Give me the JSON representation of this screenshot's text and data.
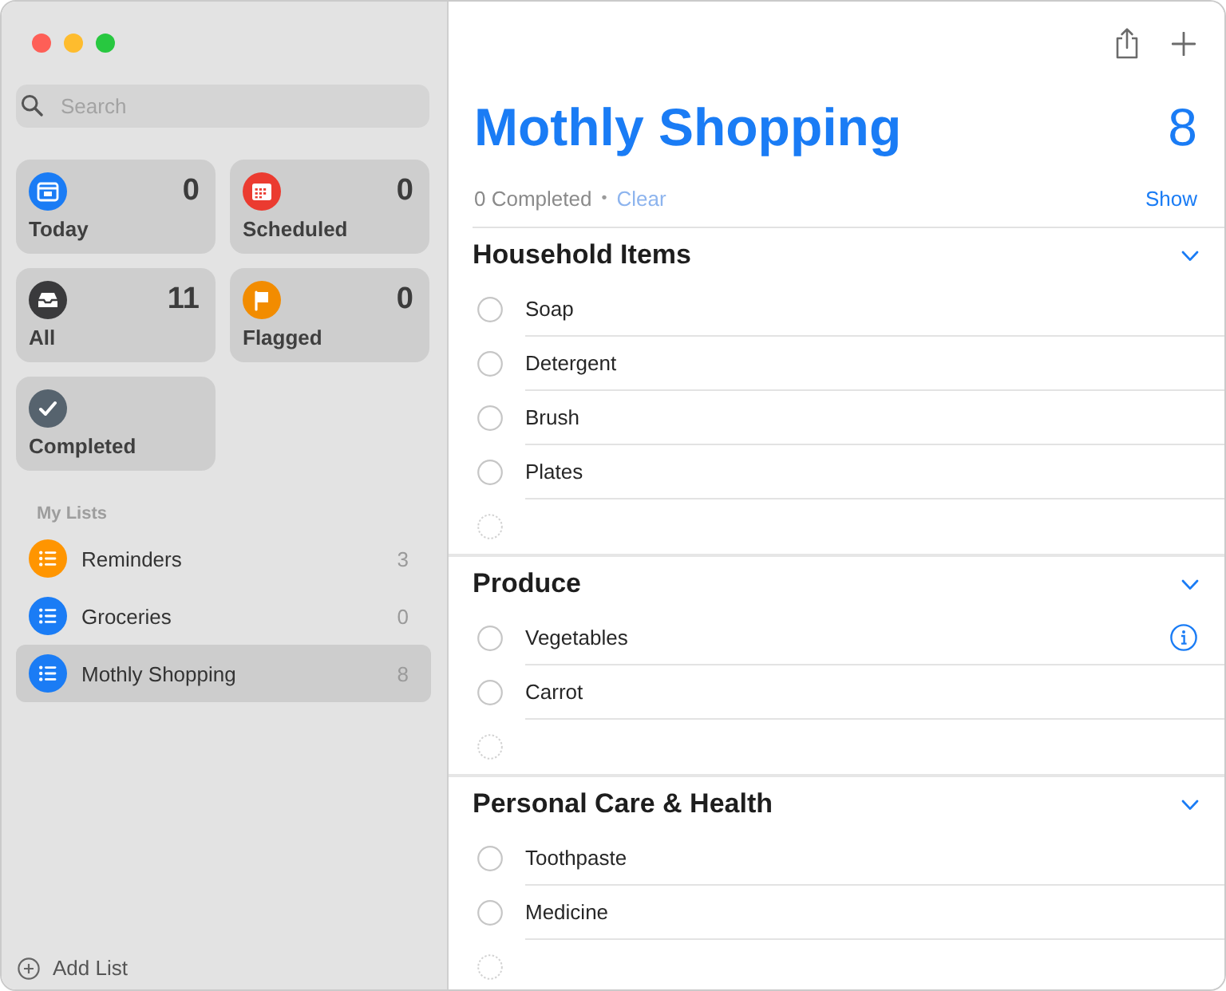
{
  "sidebar": {
    "search": {
      "placeholder": "Search"
    },
    "smart_lists": [
      {
        "kind": "today",
        "label": "Today",
        "count": "0",
        "color": "#1a7cf5"
      },
      {
        "kind": "scheduled",
        "label": "Scheduled",
        "count": "0",
        "color": "#eb3b30"
      },
      {
        "kind": "all",
        "label": "All",
        "count": "11",
        "color": "#3a3a3c"
      },
      {
        "kind": "flagged",
        "label": "Flagged",
        "count": "0",
        "color": "#f28c00"
      },
      {
        "kind": "completed",
        "label": "Completed",
        "color": "#56636e"
      }
    ],
    "my_lists_title": "My Lists",
    "lists": [
      {
        "label": "Reminders",
        "count": "3",
        "color": "#ff9500",
        "selected": false
      },
      {
        "label": "Groceries",
        "count": "0",
        "color": "#1a7cf5",
        "selected": false
      },
      {
        "label": "Mothly Shopping",
        "count": "8",
        "color": "#1a7cf5",
        "selected": true
      }
    ],
    "add_list": "Add List"
  },
  "main": {
    "title": "Mothly Shopping",
    "count": "8",
    "completed_count": "0 Completed",
    "separator": "•",
    "clear": "Clear",
    "show": "Show",
    "sections": [
      {
        "title": "Household Items",
        "expanded": true,
        "items": [
          {
            "title": "Soap",
            "checked": false,
            "info_button": false
          },
          {
            "title": "Detergent",
            "checked": false,
            "info_button": false
          },
          {
            "title": "Brush",
            "checked": false,
            "info_button": false
          },
          {
            "title": "Plates",
            "checked": false,
            "info_button": false
          }
        ]
      },
      {
        "title": "Produce",
        "expanded": true,
        "items": [
          {
            "title": "Vegetables",
            "checked": false,
            "info_button": true
          },
          {
            "title": "Carrot",
            "checked": false,
            "info_button": false
          }
        ]
      },
      {
        "title": "Personal Care & Health",
        "expanded": true,
        "items": [
          {
            "title": "Toothpaste",
            "checked": false,
            "info_button": false
          },
          {
            "title": "Medicine",
            "checked": false,
            "info_button": false
          }
        ]
      }
    ]
  }
}
